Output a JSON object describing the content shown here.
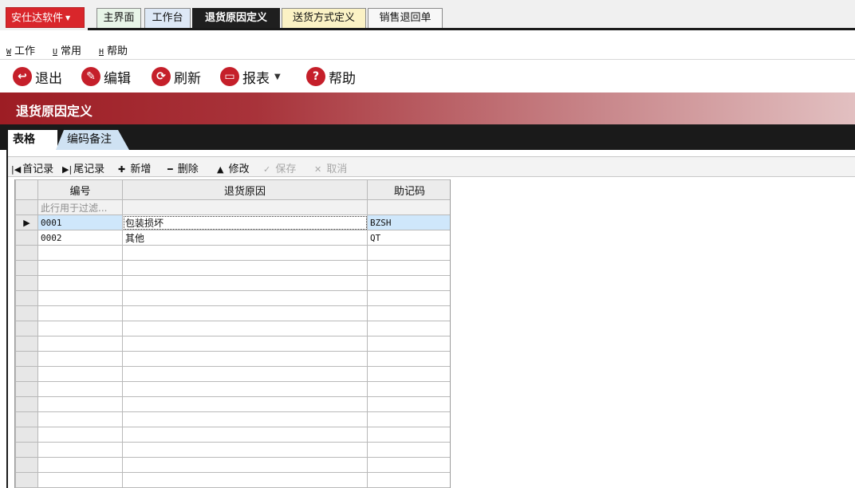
{
  "app": {
    "brand": "安仕达软件"
  },
  "tabs": [
    {
      "label": "主界面"
    },
    {
      "label": "工作台"
    },
    {
      "label": "退货原因定义"
    },
    {
      "label": "送货方式定义"
    },
    {
      "label": "销售退回单"
    }
  ],
  "menu": [
    {
      "key": "W",
      "label": "工作"
    },
    {
      "key": "U",
      "label": "常用"
    },
    {
      "key": "H",
      "label": "帮助"
    }
  ],
  "toolbar": {
    "exit": "退出",
    "edit": "编辑",
    "refresh": "刷新",
    "report": "报表",
    "help": "帮助"
  },
  "page": {
    "title": "退货原因定义"
  },
  "inner_tabs": [
    {
      "label": "表格"
    },
    {
      "label": "编码备注"
    }
  ],
  "navigator": {
    "first": "首记录",
    "last": "尾记录",
    "add": "新增",
    "delete": "删除",
    "modify": "修改",
    "save": "保存",
    "cancel": "取消"
  },
  "grid": {
    "columns": [
      "编号",
      "退货原因",
      "助记码"
    ],
    "filter_placeholder": "此行用于过滤...",
    "rows": [
      {
        "code": "0001",
        "reason": "包装损坏",
        "mnemonic": "BZSH"
      },
      {
        "code": "0002",
        "reason": "其他",
        "mnemonic": "QT"
      }
    ]
  },
  "colors": {
    "brand": "#d9262b",
    "title_gradient_start": "#9d1d24",
    "selected_row": "#cfe7fb",
    "active_tab": "#1f1f1f"
  }
}
